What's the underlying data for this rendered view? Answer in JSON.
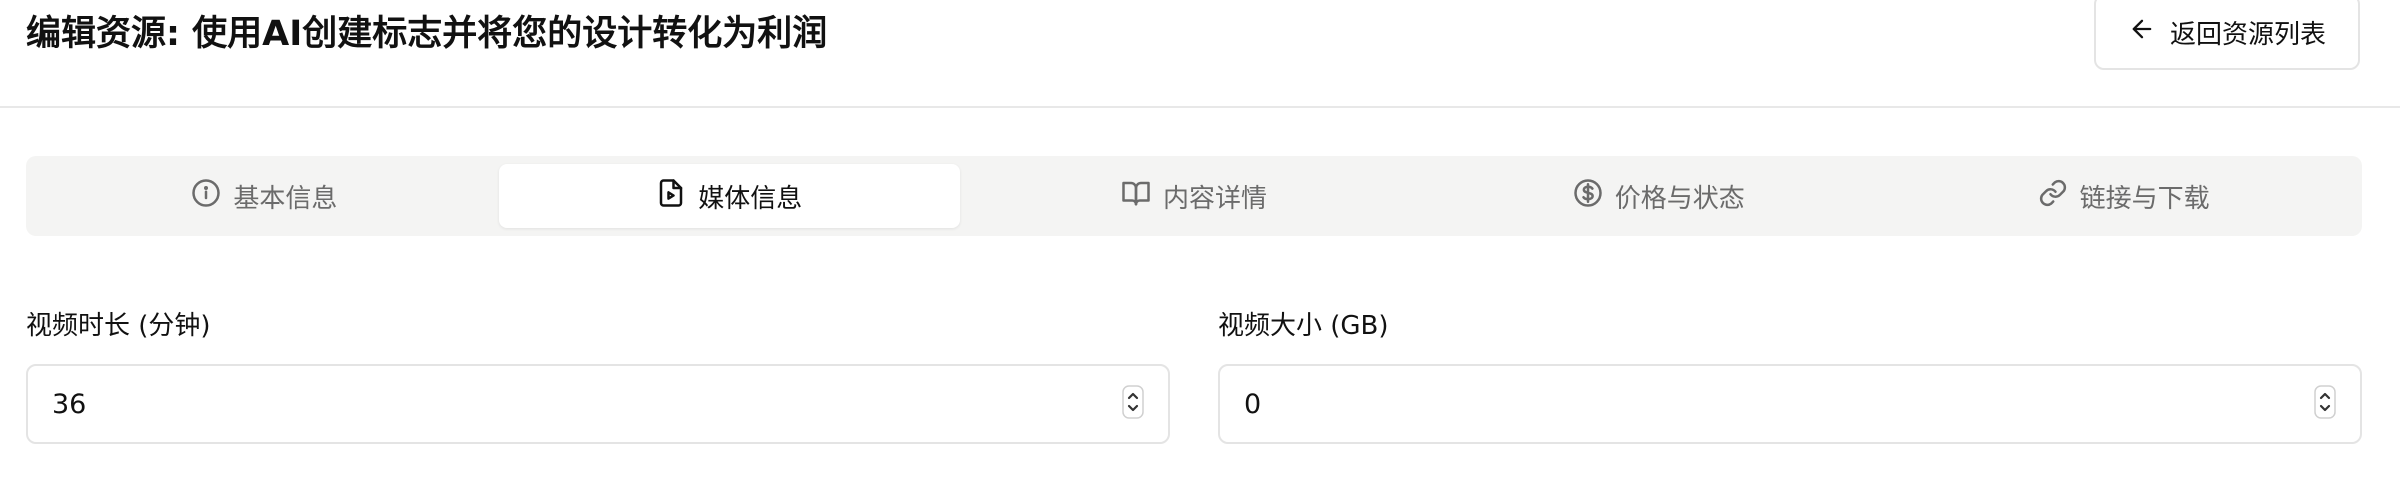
{
  "header": {
    "title": "编辑资源: 使用AI创建标志并将您的设计转化为利润",
    "back_button_label": "返回资源列表",
    "back_icon": "arrow-left-icon"
  },
  "tabs": [
    {
      "label": "基本信息",
      "icon": "info-icon",
      "active": false
    },
    {
      "label": "媒体信息",
      "icon": "file-play-icon",
      "active": true
    },
    {
      "label": "内容详情",
      "icon": "book-open-icon",
      "active": false
    },
    {
      "label": "价格与状态",
      "icon": "dollar-circle-icon",
      "active": false
    },
    {
      "label": "链接与下载",
      "icon": "link-icon",
      "active": false
    }
  ],
  "fields": {
    "video_duration": {
      "label": "视频时长 (分钟)",
      "value": "36"
    },
    "video_size": {
      "label": "视频大小 (GB)",
      "value": "0"
    }
  },
  "colors": {
    "tab_bar_bg": "#f4f4f3",
    "inactive_text": "#6b6b6b",
    "border": "#e4e4e4"
  }
}
